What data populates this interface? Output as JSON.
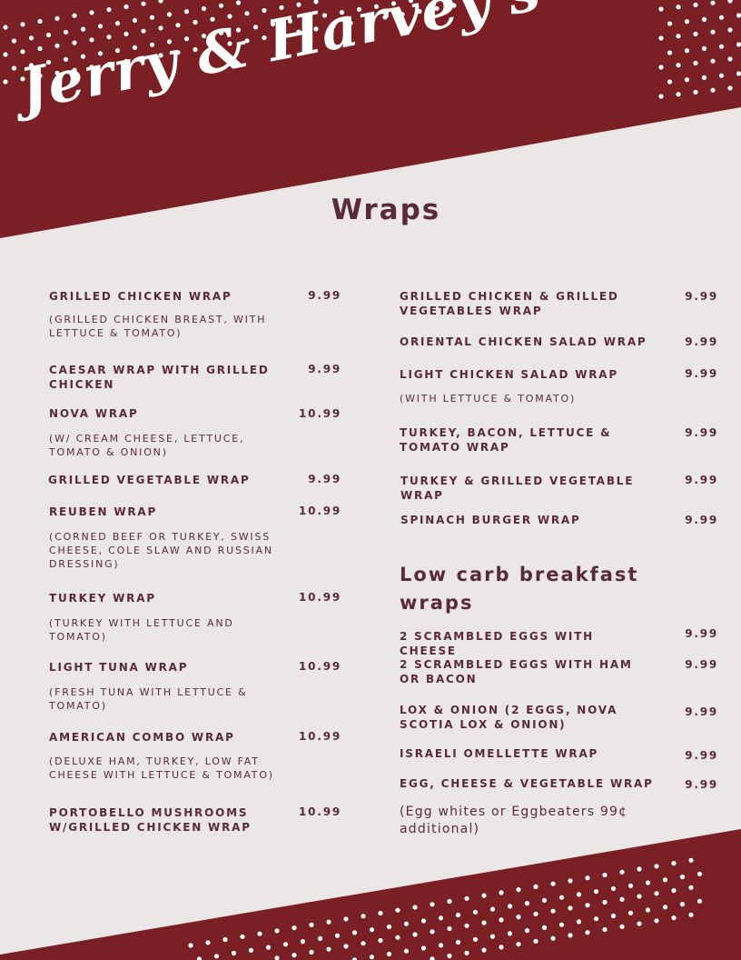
{
  "brand": "Jerry & Harvey's",
  "section_title": "Wraps",
  "left_items": [
    {
      "name": "GRILLED CHICKEN WRAP",
      "price": "9.99",
      "desc": "(GRILLED CHICKEN BREAST, WITH LETTUCE & TOMATO)"
    },
    {
      "name": "CAESAR WRAP WITH GRILLED CHICKEN",
      "price": "9.99",
      "desc": ""
    },
    {
      "name": "NOVA WRAP",
      "price": "10.99",
      "desc": "(W/ CREAM CHEESE, LETTUCE, TOMATO & ONION)"
    },
    {
      "name": "GRILLED VEGETABLE WRAP",
      "price": "9.99",
      "desc": ""
    },
    {
      "name": "REUBEN WRAP",
      "price": "10.99",
      "desc": "(CORNED BEEF OR TURKEY, SWISS CHEESE, COLE SLAW AND RUSSIAN DRESSING)"
    },
    {
      "name": "TURKEY WRAP",
      "price": "10.99",
      "desc": "(TURKEY WITH LETTUCE AND TOMATO)"
    },
    {
      "name": "LIGHT TUNA WRAP",
      "price": "10.99",
      "desc": "(FRESH TUNA WITH LETTUCE & TOMATO)"
    },
    {
      "name": "AMERICAN COMBO WRAP",
      "price": "10.99",
      "desc": "(DELUXE HAM, TURKEY, LOW FAT CHEESE WITH LETTUCE & TOMATO)"
    },
    {
      "name": "PORTOBELLO MUSHROOMS W/GRILLED CHICKEN WRAP",
      "price": "10.99",
      "desc": ""
    }
  ],
  "right_items": [
    {
      "name": "GRILLED CHICKEN & GRILLED VEGETABLES WRAP",
      "price": "9.99",
      "desc": ""
    },
    {
      "name": "ORIENTAL CHICKEN SALAD WRAP",
      "price": "9.99",
      "desc": ""
    },
    {
      "name": "LIGHT CHICKEN SALAD WRAP",
      "price": "9.99",
      "desc": "(WITH LETTUCE & TOMATO)"
    },
    {
      "name": "TURKEY, BACON, LETTUCE & TOMATO WRAP",
      "price": "9.99",
      "desc": ""
    },
    {
      "name": "TURKEY & GRILLED VEGETABLE WRAP",
      "price": "9.99",
      "desc": ""
    },
    {
      "name": "SPINACH BURGER WRAP",
      "price": "9.99",
      "desc": ""
    }
  ],
  "breakfast_heading": "Low carb breakfast wraps",
  "breakfast_items": [
    {
      "name": "2 SCRAMBLED EGGS WITH CHEESE",
      "price": "9.99"
    },
    {
      "name": "2 SCRAMBLED EGGS WITH HAM OR BACON",
      "price": "9.99"
    },
    {
      "name": "LOX & ONION (2 EGGS, NOVA SCOTIA LOX & ONION)",
      "price": "9.99"
    },
    {
      "name": "ISRAELI OMELLETTE WRAP",
      "price": "9.99"
    },
    {
      "name": "EGG, CHEESE & VEGETABLE WRAP",
      "price": "9.99"
    }
  ],
  "breakfast_note": "(Egg whites or Eggbeaters 99¢ additional)",
  "colors": {
    "maroon": "#7a1f24",
    "cream": "#ebe7e6",
    "text": "#5a2a3c",
    "dot": "#ffffff"
  }
}
